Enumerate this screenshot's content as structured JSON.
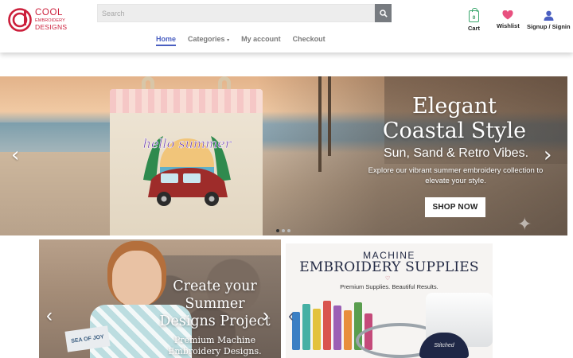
{
  "brand": {
    "logo_line1": "COOL",
    "logo_line2": "EMBROIDERY",
    "logo_line3": "DESIGNS",
    "color": "#cc1f3b"
  },
  "search": {
    "placeholder": "Search",
    "icon": "search-icon"
  },
  "nav": {
    "items": [
      {
        "label": "Home",
        "active": true
      },
      {
        "label": "Categories",
        "has_dropdown": true
      },
      {
        "label": "My account"
      },
      {
        "label": "Checkout"
      }
    ],
    "accent": "#4a5fc1"
  },
  "utility": {
    "cart_label": "Cart",
    "cart_count": "0",
    "wishlist_label": "Wishlist",
    "account_label": "Signup / Signin"
  },
  "hero": {
    "title": "Elegant Coastal Style",
    "subtitle": "Sun, Sand & Retro Vibes.",
    "description": "Explore our vibrant summer embroidery collection to elevate your style.",
    "cta": "SHOP NOW",
    "bag_text": "hello summer",
    "slides": 3,
    "active_slide": 1
  },
  "promo_left": {
    "title": "Create your Summer Designs Project",
    "subtitle": "Premium Machine Embroidery Designs.",
    "towel_text": "SEA OF JOY"
  },
  "promo_right": {
    "line1": "MACHINE",
    "line2": "EMBROIDERY SUPPLIES",
    "tagline": "Premium Supplies. Beautiful Results.",
    "cap_text": "Stitched"
  }
}
